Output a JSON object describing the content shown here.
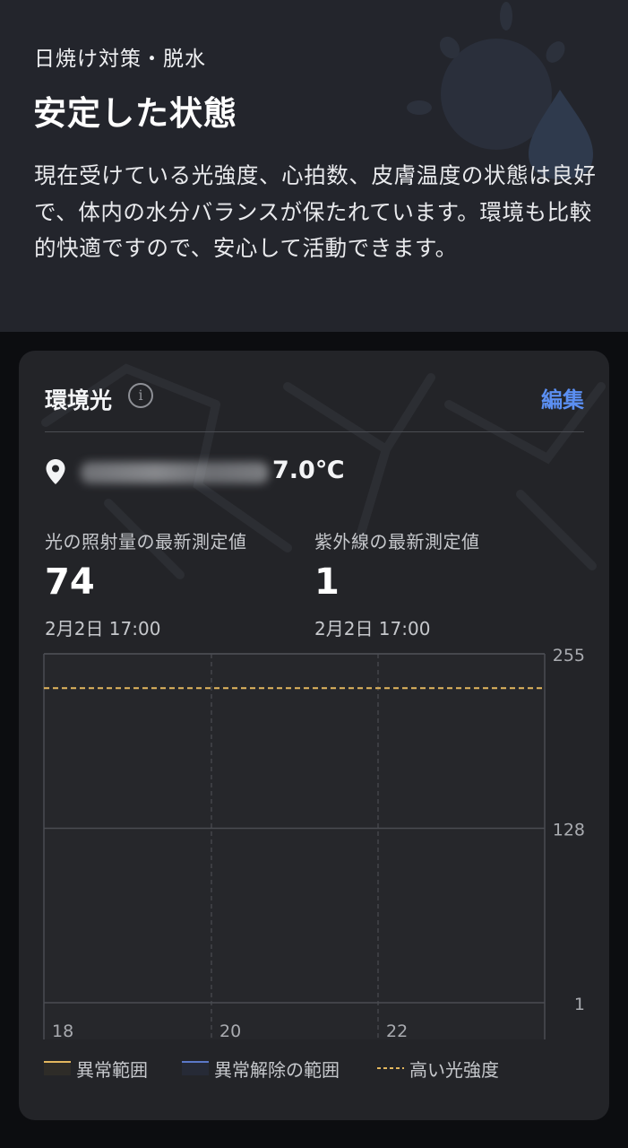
{
  "header": {
    "category": "日焼け対策・脱水",
    "status": "安定した状態",
    "description": "現在受けている光強度、心拍数、皮膚温度の状態は良好で、体内の水分バランスが保たれています。環境も比較的快適ですので、安心して活動できます。"
  },
  "card": {
    "title": "環境光",
    "info_icon": "info-icon",
    "edit_label": "編集",
    "location_icon": "location-pin-icon",
    "temperature": "7.0℃",
    "metrics": [
      {
        "label": "光の照射量の最新測定値",
        "value": "74",
        "time": "2月2日 17:00"
      },
      {
        "label": "紫外線の最新測定値",
        "value": "1",
        "time": "2月2日 17:00"
      }
    ],
    "legend": [
      {
        "label": "異常範囲",
        "color": "#e3b75e"
      },
      {
        "label": "異常解除の範囲",
        "color": "#5b78c8"
      },
      {
        "label": "高い光強度",
        "color": "#e3b75e"
      }
    ]
  },
  "chart_data": {
    "type": "line",
    "x_ticks": [
      "18",
      "20",
      "22"
    ],
    "y_ticks": [
      "255",
      "128",
      "1"
    ],
    "ylim": [
      1,
      255
    ],
    "threshold": {
      "name": "高い光強度",
      "value": 230,
      "style": "dashed",
      "color": "#e3b75e"
    },
    "series": [],
    "grid": true
  }
}
